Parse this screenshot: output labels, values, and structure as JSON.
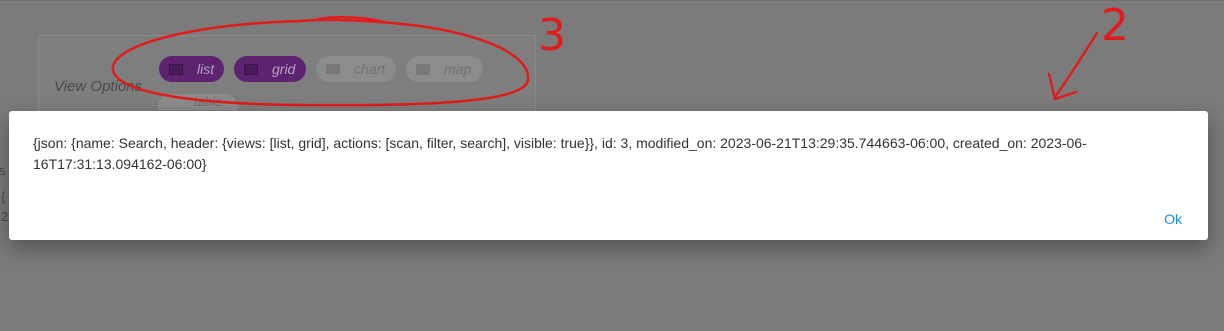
{
  "background": {
    "view_options_label": "View Options",
    "chips": [
      {
        "label": "list",
        "state": "selected"
      },
      {
        "label": "grid",
        "state": "selected"
      },
      {
        "label": "chart",
        "state": "unselected"
      },
      {
        "label": "map",
        "state": "unselected"
      },
      {
        "label": "table",
        "state": "unselected"
      }
    ],
    "fragments": [
      "js",
      "{",
      "2"
    ]
  },
  "annotations": [
    {
      "label": "3",
      "color": "#e11b1b"
    },
    {
      "label": "2",
      "color": "#e11b1b"
    }
  ],
  "modal": {
    "message": "{json: {name: Search, header: {views: [list, grid], actions: [scan, filter, search], visible: true}}, id: 3, modified_on: 2023-06-21T13:29:35.744663-06:00, created_on: 2023-06-16T17:31:13.094162-06:00}",
    "ok_label": "Ok",
    "accent_color": "#1a8ee0"
  }
}
